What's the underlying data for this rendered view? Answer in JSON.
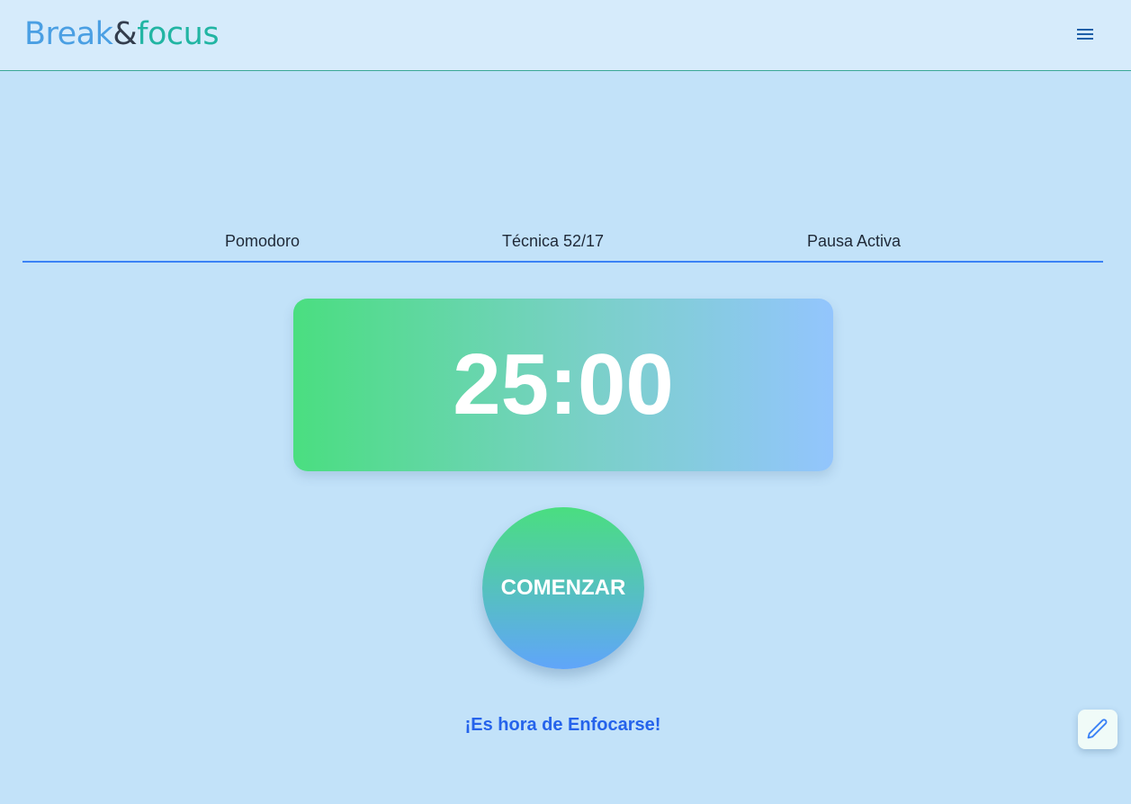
{
  "header": {
    "logo_part1": "Break",
    "logo_amp": "&",
    "logo_part2": "focus",
    "menu_icon": "hamburger-menu-icon"
  },
  "tabs": [
    {
      "label": "Pomodoro"
    },
    {
      "label": "Técnica 52/17"
    },
    {
      "label": "Pausa Activa"
    }
  ],
  "timer": {
    "display": "25:00"
  },
  "controls": {
    "start_label": "COMENZAR"
  },
  "status": {
    "message": "¡Es hora de Enfocarse!"
  },
  "floating": {
    "edit_icon": "pencil-icon"
  },
  "colors": {
    "accent": "#3b82f6",
    "status_text": "#2563eb",
    "gradient_start": "#4ade80",
    "gradient_end": "#60a5fa",
    "background": "#c2e2f9"
  }
}
